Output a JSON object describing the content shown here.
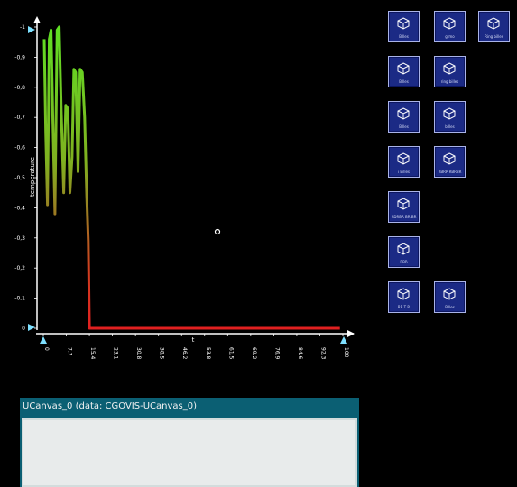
{
  "chart_data": {
    "type": "line",
    "ylabel": "temperature",
    "xlabel": "t",
    "ylim": [
      0,
      1
    ],
    "xlim": [
      0,
      100
    ],
    "y_ticks": [
      "0",
      "0,1",
      "0,2",
      "0,3",
      "0,4",
      "0,5",
      "0,6",
      "0,7",
      "0,8",
      "0,9",
      "1"
    ],
    "x_ticks": [
      "0",
      "7.7",
      "15.4",
      "23.1",
      "30.8",
      "38.5",
      "46.2",
      "53.8",
      "61.5",
      "69.2",
      "76.9",
      "84.6",
      "92.3",
      "100"
    ],
    "x": [
      0.3,
      0.8,
      1.4,
      2.0,
      2.6,
      3.2,
      3.9,
      4.6,
      5.3,
      6.0,
      6.8,
      7.5,
      8.2,
      8.9,
      9.6,
      10.2,
      10.8,
      11.6,
      12.3,
      13.0,
      13.8,
      14.5,
      15.0,
      15.4,
      16,
      20,
      30,
      40,
      50,
      60,
      70,
      80,
      90,
      95,
      97,
      99
    ],
    "y": [
      0.96,
      0.65,
      0.41,
      0.96,
      0.99,
      0.69,
      0.38,
      0.99,
      1.0,
      0.72,
      0.45,
      0.74,
      0.73,
      0.45,
      0.57,
      0.86,
      0.85,
      0.52,
      0.86,
      0.85,
      0.7,
      0.44,
      0.29,
      0.0,
      0.0,
      0.0,
      0.0,
      0.0,
      0.0,
      0.0,
      0.0,
      0.0,
      0.0,
      0.0,
      0.0,
      0.0
    ],
    "colors": {
      "high": "#5fe023",
      "mid": "#9c7a22",
      "low": "#e02020",
      "axis": "#ffffff",
      "arrow": "#7ee0ff"
    }
  },
  "cursor_marker": {
    "style": "ring",
    "color": "#ffffff"
  },
  "tiles": [
    {
      "label": "Billes",
      "icon": "cube-icon"
    },
    {
      "label": "grmo",
      "icon": "cube-icon"
    },
    {
      "label": "Ring billes",
      "icon": "cube-icon"
    },
    {
      "label": "Billes",
      "icon": "cube-icon"
    },
    {
      "label": "ring billes",
      "icon": "cube-icon"
    },
    {
      "label": "Billes",
      "icon": "cube-icon"
    },
    {
      "label": "billes",
      "icon": "cube-icon"
    },
    {
      "label": "i Billes",
      "icon": "cube-icon"
    },
    {
      "label": "RBRP RBRBR",
      "icon": "cube-icon"
    },
    {
      "label": "RDRBR BR BR",
      "icon": "cube-icon"
    },
    {
      "label": "RBR",
      "icon": "cube-icon"
    },
    {
      "label": "RB T R",
      "icon": "cube-icon"
    },
    {
      "label": "Billes",
      "icon": "cube-icon"
    }
  ],
  "canvas": {
    "title": "UCanvas_0 (data: CGOVIS-UCanvas_0)",
    "colors": {
      "header": "#0b5f73",
      "body": "#e8ebeb"
    }
  }
}
